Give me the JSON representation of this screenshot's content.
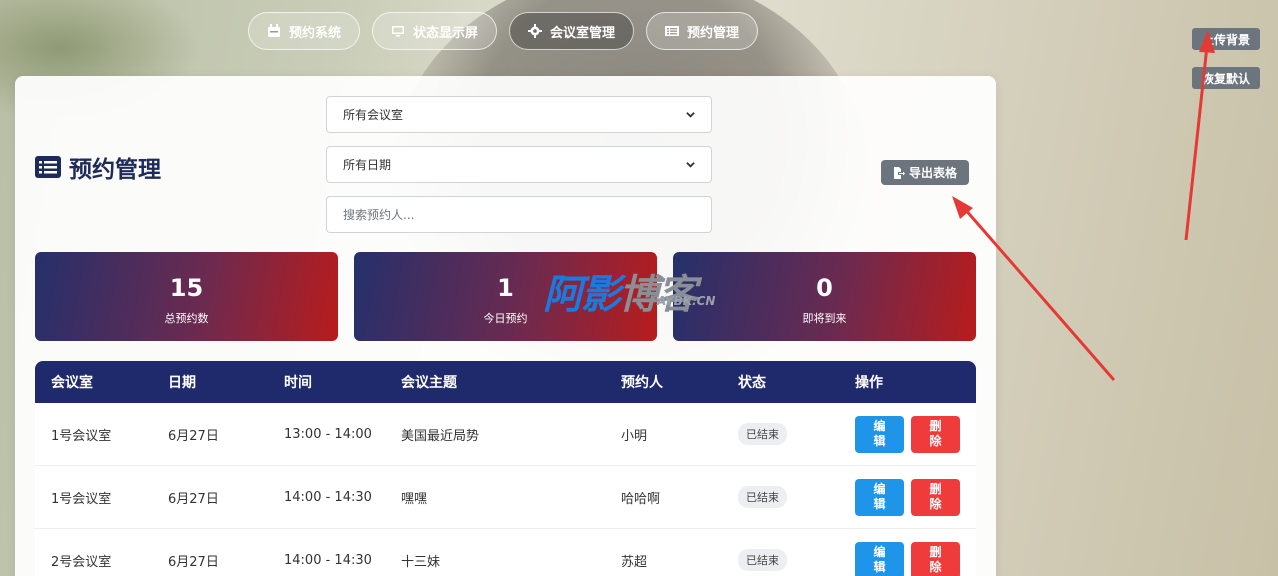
{
  "nav": [
    {
      "label": "预约系统",
      "icon": "calendar-icon",
      "active": false
    },
    {
      "label": "状态显示屏",
      "icon": "monitor-icon",
      "active": false
    },
    {
      "label": "会议室管理",
      "icon": "gear-icon",
      "active": true
    },
    {
      "label": "预约管理",
      "icon": "list-icon",
      "active": false
    }
  ],
  "side": {
    "upload_label": "上传背景",
    "reset_label": "恢复默认"
  },
  "page": {
    "title": "预约管理",
    "title_icon": "list-icon"
  },
  "filters": {
    "room_selected": "所有会议室",
    "date_selected": "所有日期",
    "search_placeholder": "搜索预约人..."
  },
  "export_label": "导出表格",
  "stats": [
    {
      "value": "15",
      "label": "总预约数"
    },
    {
      "value": "1",
      "label": "今日预约"
    },
    {
      "value": "0",
      "label": "即将到来"
    }
  ],
  "table": {
    "headers": [
      "会议室",
      "日期",
      "时间",
      "会议主题",
      "预约人",
      "状态",
      "操作"
    ],
    "rows": [
      {
        "room": "1号会议室",
        "date": "6月27日",
        "time": "13:00 - 14:00",
        "topic": "美国最近局势",
        "person": "小明",
        "status": "已结束"
      },
      {
        "room": "1号会议室",
        "date": "6月27日",
        "time": "14:00 - 14:30",
        "topic": "嘿嘿",
        "person": "哈哈啊",
        "status": "已结束"
      },
      {
        "room": "2号会议室",
        "date": "6月27日",
        "time": "14:00 - 14:30",
        "topic": "十三妹",
        "person": "苏超",
        "status": "已结束"
      }
    ],
    "edit_label_1": "编",
    "edit_label_2": "辑",
    "delete_label_1": "删",
    "delete_label_2": "除"
  },
  "watermark": {
    "main_a": "阿影",
    "main_b": "博客",
    "sub": "AYBK.CN"
  },
  "colors": {
    "nav_dark": "#1e2a6b",
    "edit": "#1e95e8",
    "delete": "#ef3b3b",
    "arrow": "#e53935"
  }
}
